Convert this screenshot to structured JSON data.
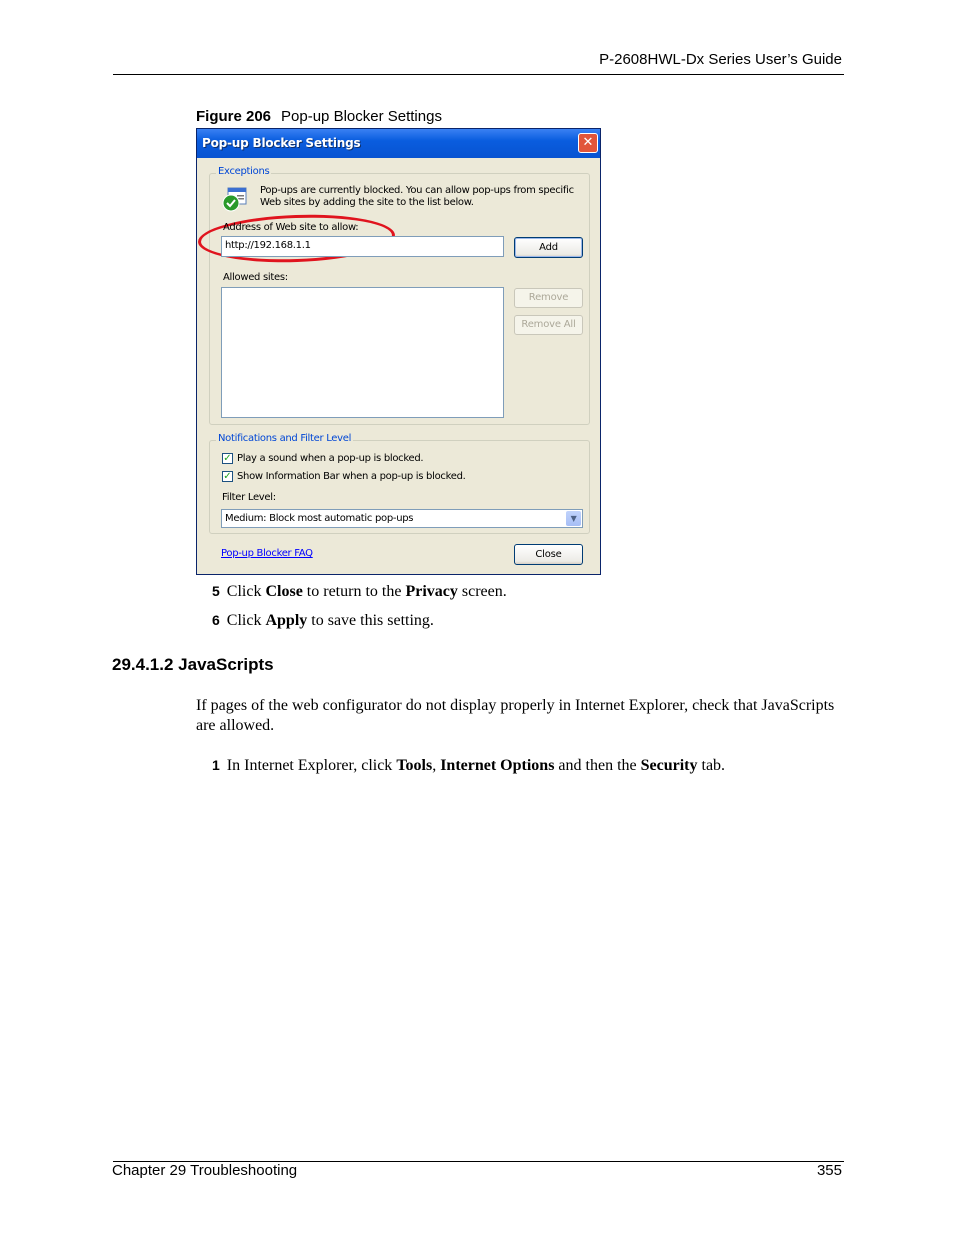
{
  "header": {
    "title": "P-2608HWL-Dx Series User’s Guide"
  },
  "figure": {
    "label": "Figure 206",
    "title": "Pop-up Blocker Settings"
  },
  "dialog": {
    "title": "Pop-up Blocker Settings",
    "close_glyph": "✕",
    "exceptions": {
      "legend": "Exceptions",
      "info_line1": "Pop-ups are currently blocked.  You can allow pop-ups from specific",
      "info_line2": "Web sites by adding the site to the list below.",
      "address_label": "Address of Web site to allow:",
      "address_value": "http://192.168.1.1",
      "add_button": "Add",
      "allowed_label": "Allowed sites:",
      "remove_button": "Remove",
      "remove_all_button": "Remove All"
    },
    "notifications": {
      "legend": "Notifications and Filter Level",
      "checkbox1": "Play a sound when a pop-up is blocked.",
      "checkbox1_checked": true,
      "checkbox2": "Show Information Bar when a pop-up is blocked.",
      "checkbox2_checked": true,
      "filter_label": "Filter Level:",
      "filter_value": "Medium: Block most automatic pop-ups"
    },
    "faq_link": "Pop-up Blocker FAQ",
    "close_button": "Close"
  },
  "steps": [
    {
      "num": "5",
      "parts": [
        "Click ",
        "Close",
        " to return to the ",
        "Privacy",
        " screen."
      ]
    },
    {
      "num": "6",
      "parts": [
        "Click ",
        "Apply",
        " to save this setting."
      ]
    }
  ],
  "section": {
    "heading": "29.4.1.2  JavaScripts",
    "paragraph": "If pages of the web configurator do not display properly in Internet Explorer, check that JavaScripts are allowed.",
    "step": {
      "num": "1",
      "parts": [
        "In Internet Explorer, click ",
        "Tools",
        ", ",
        "Internet Options",
        " and then the ",
        "Security",
        " tab."
      ]
    }
  },
  "footer": {
    "left": "Chapter 29 Troubleshooting",
    "right": "355"
  },
  "colors": {
    "titlebar": "#0a5ddf",
    "highlight_ellipse": "#e0141e",
    "dialog_bg": "#ece9d8"
  }
}
